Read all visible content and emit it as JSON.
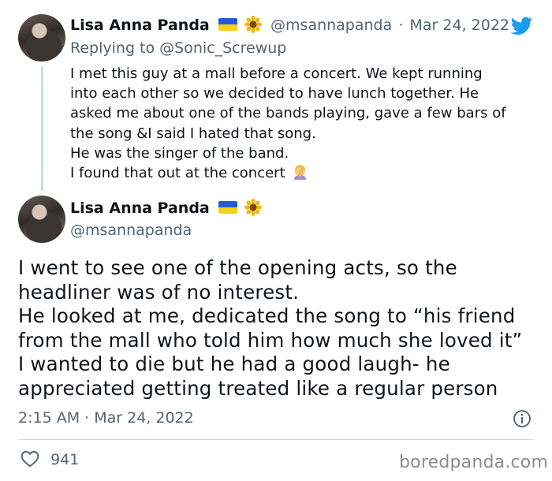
{
  "tweet1": {
    "name": "Lisa Anna Panda",
    "handle": "@msannapanda",
    "separator": "·",
    "date": "Mar 24, 2022",
    "replying_to": "Replying to @Sonic_Screwup",
    "lines": [
      "I met this guy at a mall before a concert. We kept running",
      "into each other so we decided to have lunch together. He",
      "asked me about one of the bands playing, gave a few bars of",
      "the song &I said I hated that song.",
      "He was the singer of the band.",
      "I found that out at the concert"
    ]
  },
  "tweet2": {
    "name": "Lisa Anna Panda",
    "handle": "@msannapanda",
    "lines": [
      "I went to see one of the opening acts, so the",
      "headliner was of no interest.",
      "He looked at me, dedicated the song to “his friend",
      "from the mall who told him how much she loved it”",
      "I wanted to die but he had a good laugh- he",
      "appreciated getting treated like a regular person"
    ],
    "timestamp": "2:15 AM · Mar 24, 2022",
    "like_count": "941"
  },
  "watermark": "boredpanda.com",
  "icons": {
    "platform": "twitter-bird-icon",
    "like": "heart-icon",
    "info": "info-icon",
    "facepalm": "facepalm-emoji-icon",
    "flag": "ukraine-flag-icon",
    "sunflower": "sunflower-emoji-icon"
  },
  "colors": {
    "twitter_blue": "#1d9bf0",
    "text": "#0f1419",
    "secondary": "#536471",
    "divider": "#cfd9de"
  }
}
